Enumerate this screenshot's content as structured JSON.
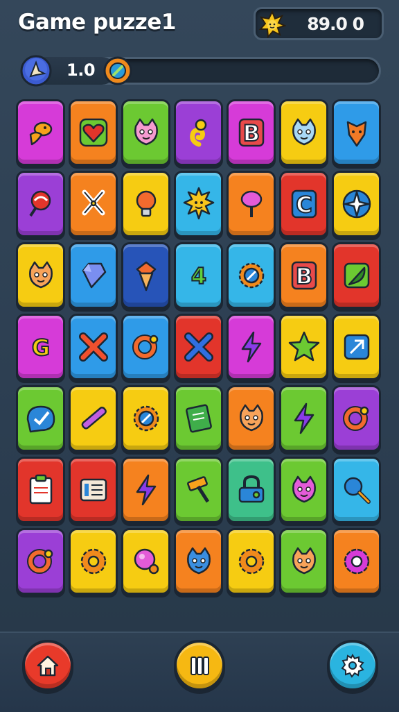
{
  "header": {
    "title": "Game puzze1",
    "score": "89.0 0"
  },
  "progress": {
    "level_text": "1.0",
    "fraction": 0.24
  },
  "colors": {
    "magenta": "#d63bd8",
    "orange": "#f5821f",
    "green": "#6cc932",
    "purple": "#9b3fd6",
    "yellow": "#f6cc12",
    "blue": "#2f9be8",
    "red": "#e2352b",
    "navy": "#2754b8",
    "cyan": "#35b6e8",
    "teal": "#3ec08a"
  },
  "grid": {
    "rows": [
      [
        {
          "color": "magenta",
          "icon": "bird-icon"
        },
        {
          "color": "orange",
          "icon": "heart-icon"
        },
        {
          "color": "green",
          "icon": "pink-creature-icon"
        },
        {
          "color": "purple",
          "icon": "swirl-icon"
        },
        {
          "color": "magenta",
          "icon": "letter-b-icon",
          "letter": "B"
        },
        {
          "color": "yellow",
          "icon": "ghost-icon"
        },
        {
          "color": "blue",
          "icon": "fox-face-icon"
        }
      ],
      [
        {
          "color": "purple",
          "icon": "lollipop-swirl-icon"
        },
        {
          "color": "orange",
          "icon": "scissors-icon"
        },
        {
          "color": "yellow",
          "icon": "light-bulb-icon"
        },
        {
          "color": "cyan",
          "icon": "sun-face-icon"
        },
        {
          "color": "orange",
          "icon": "lollipop-icon"
        },
        {
          "color": "red",
          "icon": "letter-c-icon",
          "letter": "C"
        },
        {
          "color": "yellow",
          "icon": "compass-icon"
        }
      ],
      [
        {
          "color": "yellow",
          "icon": "cat-face-icon"
        },
        {
          "color": "blue",
          "icon": "gem-icon"
        },
        {
          "color": "navy",
          "icon": "ice-cream-icon"
        },
        {
          "color": "cyan",
          "icon": "number-4-icon",
          "letter": "4"
        },
        {
          "color": "cyan",
          "icon": "gear-compass-icon"
        },
        {
          "color": "orange",
          "icon": "letter-b-icon",
          "letter": "B"
        },
        {
          "color": "red",
          "icon": "leaf-icon"
        }
      ],
      [
        {
          "color": "magenta",
          "icon": "letter-g-icon",
          "letter": "G"
        },
        {
          "color": "blue",
          "icon": "x-mark-icon"
        },
        {
          "color": "blue",
          "icon": "orange-ring-icon"
        },
        {
          "color": "red",
          "icon": "x-cross-icon"
        },
        {
          "color": "magenta",
          "icon": "lightning-icon"
        },
        {
          "color": "yellow",
          "icon": "star-icon"
        },
        {
          "color": "yellow",
          "icon": "square-arrow-icon"
        }
      ],
      [
        {
          "color": "green",
          "icon": "check-badge-icon"
        },
        {
          "color": "yellow",
          "icon": "pencil-icon"
        },
        {
          "color": "yellow",
          "icon": "gear-icon"
        },
        {
          "color": "green",
          "icon": "notepad-icon"
        },
        {
          "color": "orange",
          "icon": "cat-face-icon"
        },
        {
          "color": "green",
          "icon": "lightning-icon"
        },
        {
          "color": "purple",
          "icon": "ring-icon"
        }
      ],
      [
        {
          "color": "red",
          "icon": "clipboard-icon"
        },
        {
          "color": "red",
          "icon": "list-icon"
        },
        {
          "color": "orange",
          "icon": "lightning-icon"
        },
        {
          "color": "green",
          "icon": "hammer-icon"
        },
        {
          "color": "teal",
          "icon": "lock-icon"
        },
        {
          "color": "green",
          "icon": "robot-face-icon"
        },
        {
          "color": "cyan",
          "icon": "magnifier-icon"
        }
      ],
      [
        {
          "color": "purple",
          "icon": "ring-icon"
        },
        {
          "color": "yellow",
          "icon": "cookie-icon"
        },
        {
          "color": "yellow",
          "icon": "ball-icon"
        },
        {
          "color": "orange",
          "icon": "blue-face-icon"
        },
        {
          "color": "yellow",
          "icon": "donut-icon"
        },
        {
          "color": "green",
          "icon": "cat-face-icon"
        },
        {
          "color": "orange",
          "icon": "flower-icon"
        }
      ]
    ]
  },
  "bottom_bar": {
    "buttons": [
      {
        "name": "home-button",
        "icon": "home-icon",
        "color": "#e83a2a"
      },
      {
        "name": "pause-button",
        "icon": "pause-icon",
        "color": "#f6b812"
      },
      {
        "name": "settings-button",
        "icon": "gear-icon",
        "color": "#2ab4e0"
      }
    ]
  }
}
